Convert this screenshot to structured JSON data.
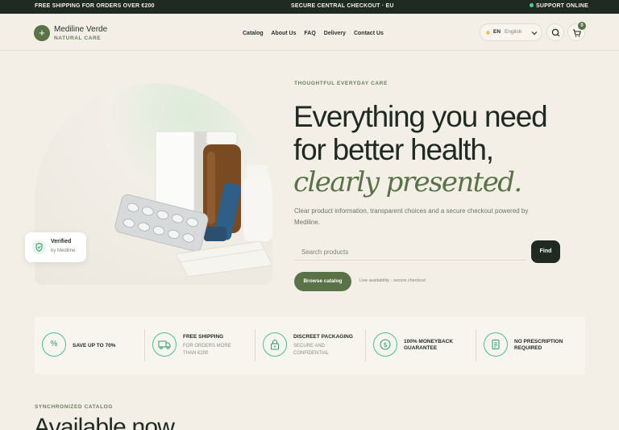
{
  "topbar": {
    "left": "FREE SHIPPING FOR ORDERS OVER €200",
    "center": "SECURE CENTRAL CHECKOUT · EU",
    "right": "SUPPORT ONLINE"
  },
  "header": {
    "logo_symbol": "+",
    "brand": "Mediline Verde",
    "brand_sub": "NATURAL CARE",
    "nav": [
      "Catalog",
      "About Us",
      "FAQ",
      "Delivery",
      "Contact Us"
    ],
    "lang_code": "EN",
    "lang_name": "English",
    "cart_count": "0"
  },
  "hero": {
    "eyebrow": "THOUGHTFUL EVERYDAY CARE",
    "title_line1": "Everything you need",
    "title_line2": "for better health,",
    "title_line3": "clearly presented.",
    "description": "Clear product information, transparent choices and a secure checkout powered by Mediline.",
    "search_placeholder": "Search products",
    "find_label": "Find",
    "browse_label": "Browse catalog",
    "availability_note": "Live availability · secure checkout",
    "verified_title": "Verified",
    "verified_sub": "by Mediline"
  },
  "features": [
    {
      "icon": "percent-icon",
      "title": "SAVE UP TO 70%",
      "sub": []
    },
    {
      "icon": "truck-icon",
      "title": "FREE SHIPPING",
      "sub": [
        "FOR ORDERS MORE",
        "THAN €200"
      ]
    },
    {
      "icon": "lock-icon",
      "title": "DISCREET PACKAGING",
      "sub": [
        "SECURE AND",
        "CONFIDENTIAL"
      ]
    },
    {
      "icon": "money-back-icon",
      "title": [
        "100% MONEYBACK",
        "GUARANTEE"
      ],
      "sub": []
    },
    {
      "icon": "prescription-icon",
      "title": [
        "NO PRESCRIPTION",
        "REQUIRED"
      ],
      "sub": []
    }
  ],
  "catalog": {
    "eyebrow": "SYNCHRONIZED CATALOG",
    "title": "Available now"
  },
  "colors": {
    "accent": "#5a7247",
    "dark": "#1e2a22",
    "feature_ring": "#4cbf8a",
    "background": "#f3efe7"
  }
}
